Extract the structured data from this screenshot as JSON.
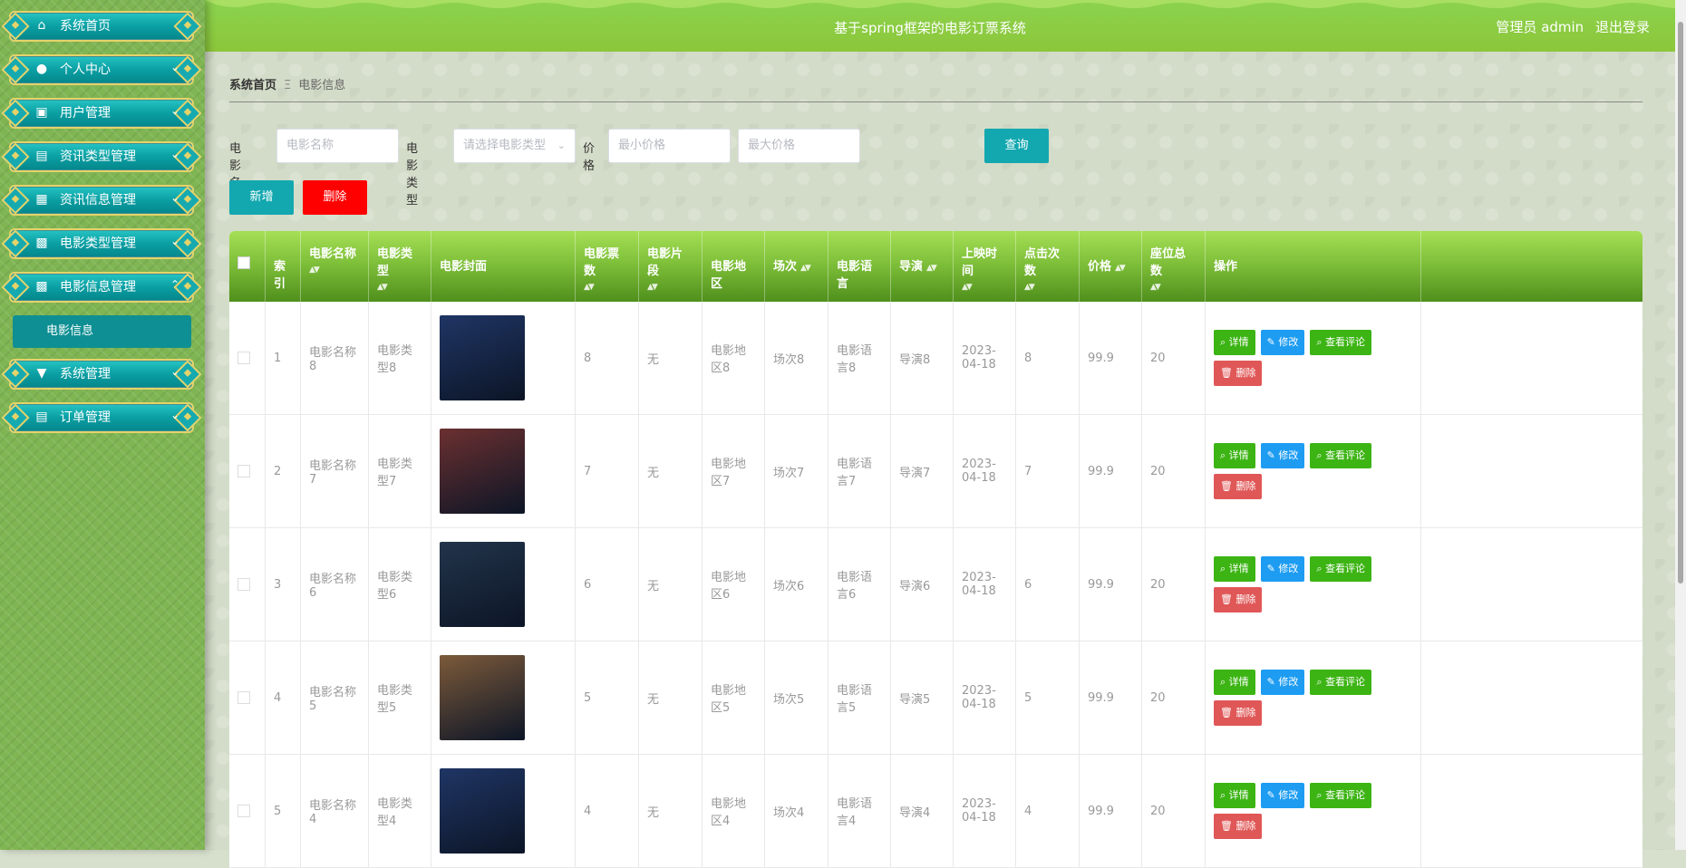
{
  "sidebar": {
    "items": [
      {
        "label": "系统首页",
        "icon": "home-icon",
        "glyph": "⌂",
        "chevron": ""
      },
      {
        "label": "个人中心",
        "icon": "user-icon",
        "glyph": "●",
        "chevron": "⌄"
      },
      {
        "label": "用户管理",
        "icon": "briefcase-icon",
        "glyph": "▣",
        "chevron": "⌄"
      },
      {
        "label": "资讯类型管理",
        "icon": "clipboard-icon",
        "glyph": "▤",
        "chevron": "⌄"
      },
      {
        "label": "资讯信息管理",
        "icon": "grid-icon",
        "glyph": "▦",
        "chevron": "⌄"
      },
      {
        "label": "电影类型管理",
        "icon": "apps-icon",
        "glyph": "▩",
        "chevron": "⌄"
      },
      {
        "label": "电影信息管理",
        "icon": "apps-icon",
        "glyph": "▩",
        "chevron": "⌃"
      },
      {
        "label": "系统管理",
        "icon": "pushpin-icon",
        "glyph": "▼",
        "chevron": "⌄"
      },
      {
        "label": "订单管理",
        "icon": "order-icon",
        "glyph": "▤",
        "chevron": "⌄"
      }
    ],
    "active_sub": "电影信息"
  },
  "header": {
    "title": "基于spring框架的电影订票系统",
    "user": "管理员 admin",
    "logout": "退出登录"
  },
  "breadcrumb": {
    "home": "系统首页",
    "sep": "Ξ",
    "current": "电影信息"
  },
  "search": {
    "name_label": "电影名称",
    "name_placeholder": "电影名称",
    "type_label": "电影类型",
    "type_placeholder": "请选择电影类型",
    "price_label": "价格",
    "min_placeholder": "最小价格",
    "max_placeholder": "最大价格",
    "query_button": "查询"
  },
  "actions": {
    "add": "新增",
    "delete": "删除"
  },
  "table": {
    "headers": [
      "索引",
      "电影名称",
      "电影类型",
      "电影封面",
      "电影票数",
      "电影片段",
      "电影地区",
      "场次",
      "电影语言",
      "导演",
      "上映时间",
      "点击次数",
      "价格",
      "座位总数",
      "操作"
    ],
    "row_buttons": {
      "detail": "详情",
      "edit": "修改",
      "comments": "查看评论",
      "delete": "删除"
    },
    "rows": [
      {
        "index": "1",
        "name": "电影名称8",
        "type": "电影类型8",
        "tickets": "8",
        "clip": "无",
        "region": "电影地区8",
        "session": "场次8",
        "language": "电影语言8",
        "director": "导演8",
        "date": "2023-04-18",
        "clicks": "8",
        "price": "99.9",
        "seats": "20",
        "poster": "The Greatest Showman poster",
        "poster_bg": "#1f3564"
      },
      {
        "index": "2",
        "name": "电影名称7",
        "type": "电影类型7",
        "tickets": "7",
        "clip": "无",
        "region": "电影地区7",
        "session": "场次7",
        "language": "电影语言7",
        "director": "导演7",
        "date": "2023-04-18",
        "clicks": "7",
        "price": "99.9",
        "seats": "20",
        "poster": "Top Gun poster",
        "poster_bg": "#6b3030"
      },
      {
        "index": "3",
        "name": "电影名称6",
        "type": "电影类型6",
        "tickets": "6",
        "clip": "无",
        "region": "电影地区6",
        "session": "场次6",
        "language": "电影语言6",
        "director": "导演6",
        "date": "2023-04-18",
        "clicks": "6",
        "price": "99.9",
        "seats": "20",
        "poster": "dark blue portrait poster",
        "poster_bg": "#22344a"
      },
      {
        "index": "4",
        "name": "电影名称5",
        "type": "电影类型5",
        "tickets": "5",
        "clip": "无",
        "region": "电影地区5",
        "session": "场次5",
        "language": "电影语言5",
        "director": "导演5",
        "date": "2023-04-18",
        "clicks": "5",
        "price": "99.9",
        "seats": "20",
        "poster": "family group poster",
        "poster_bg": "#7c5a3a"
      },
      {
        "index": "5",
        "name": "电影名称4",
        "type": "电影类型4",
        "tickets": "4",
        "clip": "无",
        "region": "电影地区4",
        "session": "场次4",
        "language": "电影语言4",
        "director": "导演4",
        "date": "2023-04-18",
        "clicks": "4",
        "price": "99.9",
        "seats": "20",
        "poster": "The Greatest Showman poster",
        "poster_bg": "#1f3564"
      }
    ]
  }
}
